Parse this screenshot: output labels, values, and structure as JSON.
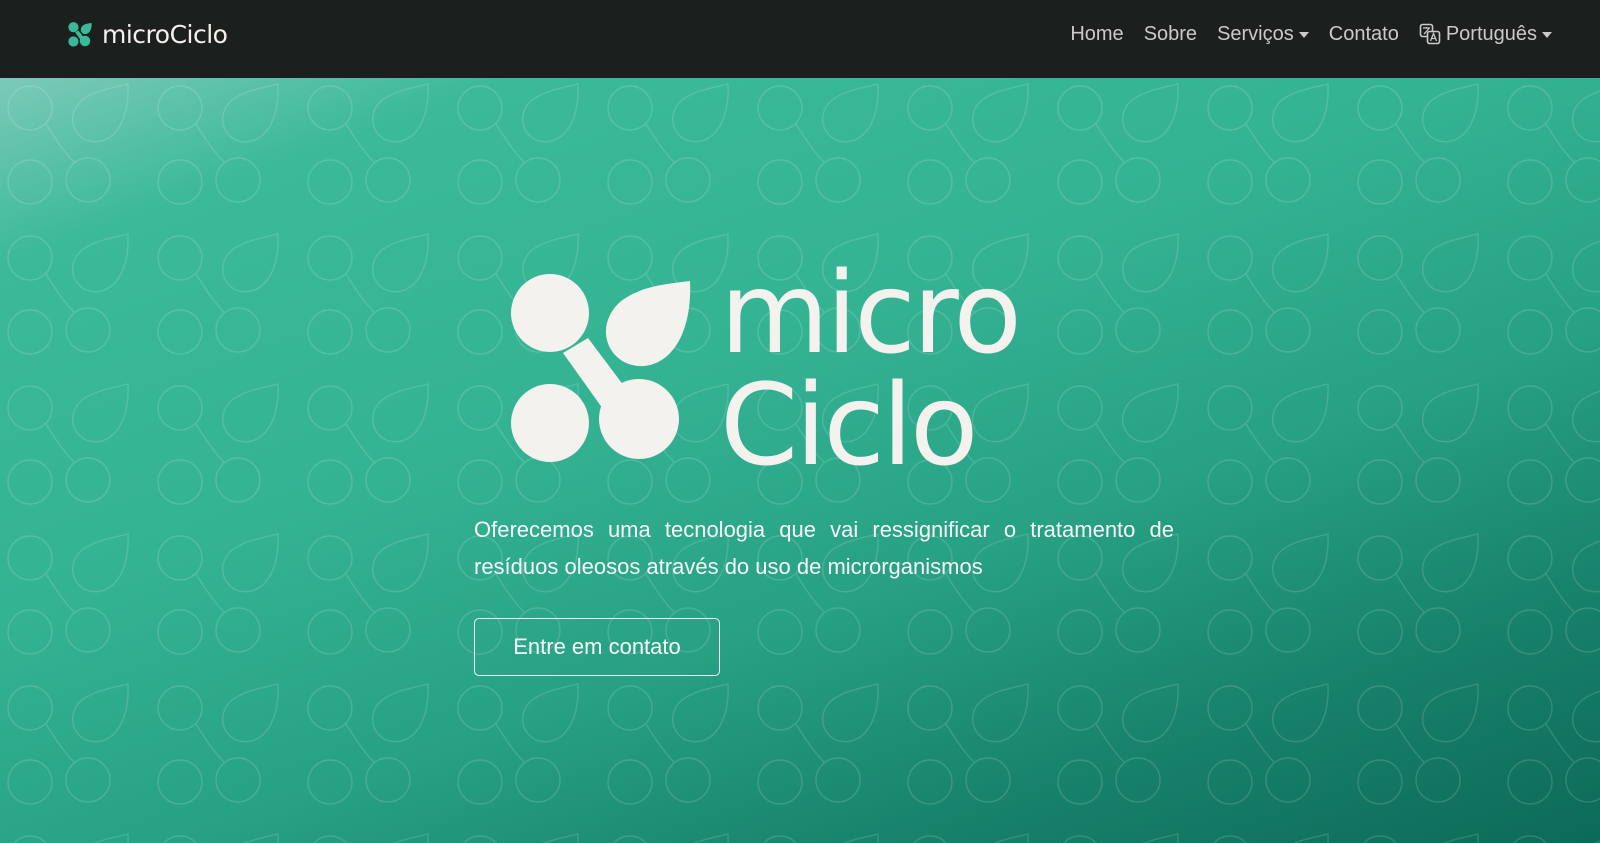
{
  "navbar": {
    "brand": {
      "text": "microCiclo",
      "icon": "microciclo-logo-icon"
    },
    "links": [
      {
        "label": "Home"
      },
      {
        "label": "Sobre"
      },
      {
        "label": "Serviços",
        "icon": "caret-down-icon"
      },
      {
        "label": "Contato"
      },
      {
        "label": "Português",
        "icon": "translate-icon"
      }
    ]
  },
  "hero": {
    "logo_line1": "micro",
    "logo_line2": "Ciclo",
    "logo_icon": "microciclo-logo-icon",
    "tagline": "Oferecemos uma tecnologia que vai ressignificar o tratamento de resíduos oleosos através do uso de microrganismos",
    "cta_label": "Entre em contato"
  },
  "colors": {
    "navbar_bg": "#1b1f1e",
    "hero_gradient_start": "#3bb999",
    "hero_gradient_end": "#0c6a58",
    "logo_white": "#f4f2ee",
    "brand_icon": "#3bb999"
  }
}
